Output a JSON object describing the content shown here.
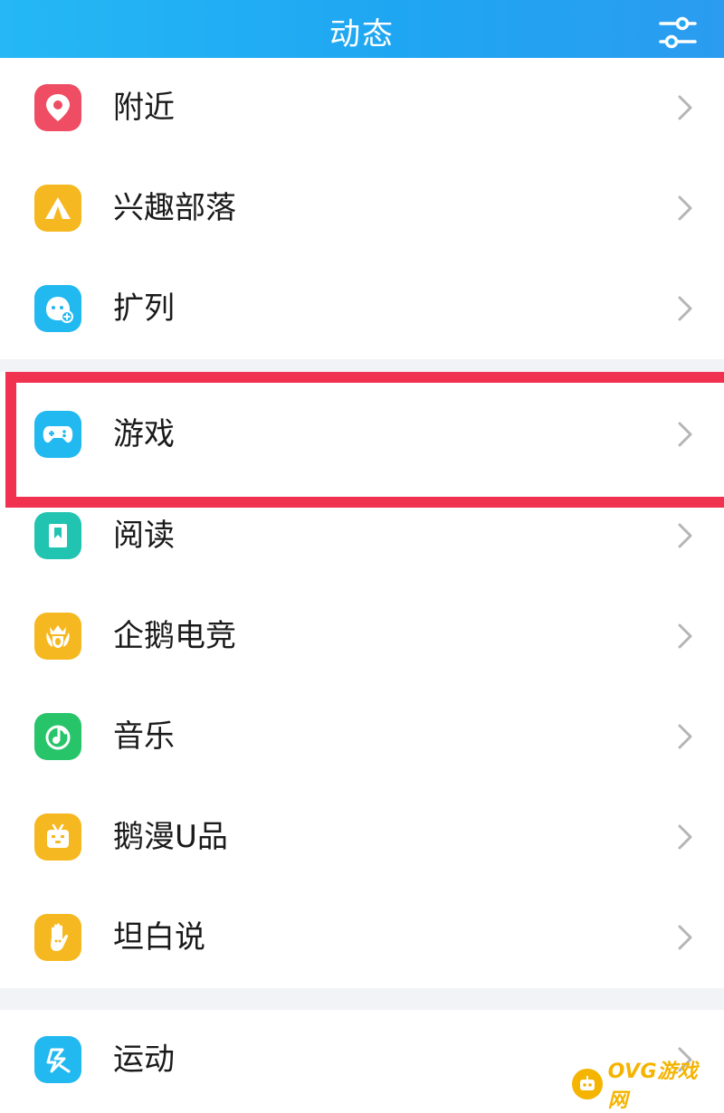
{
  "header": {
    "title": "动态",
    "settings_icon": "sliders-icon"
  },
  "colors": {
    "accent": "#22a9f2",
    "highlight": "#f0314f",
    "chevron": "#b5b5b5",
    "watermark": "#f4b400"
  },
  "items": [
    {
      "label": "附近",
      "icon": "location-pin-icon",
      "color": "#ef4d63"
    },
    {
      "label": "兴趣部落",
      "icon": "tent-icon",
      "color": "#f6b820"
    },
    {
      "label": "扩列",
      "icon": "add-friend-icon",
      "color": "#22b8f0"
    },
    {
      "label": "游戏",
      "icon": "gamepad-icon",
      "color": "#22b8f0"
    },
    {
      "label": "阅读",
      "icon": "book-icon",
      "color": "#20c4b0"
    },
    {
      "label": "企鹅电竞",
      "icon": "esports-crown-icon",
      "color": "#f6b820"
    },
    {
      "label": "音乐",
      "icon": "music-note-icon",
      "color": "#27c46a"
    },
    {
      "label": "鹅漫U品",
      "icon": "tv-mascot-icon",
      "color": "#f6b820"
    },
    {
      "label": "坦白说",
      "icon": "raised-hand-icon",
      "color": "#f6b820"
    },
    {
      "label": "运动",
      "icon": "runner-icon",
      "color": "#22b8f0"
    }
  ],
  "watermark": {
    "text": "OVG游戏网"
  }
}
